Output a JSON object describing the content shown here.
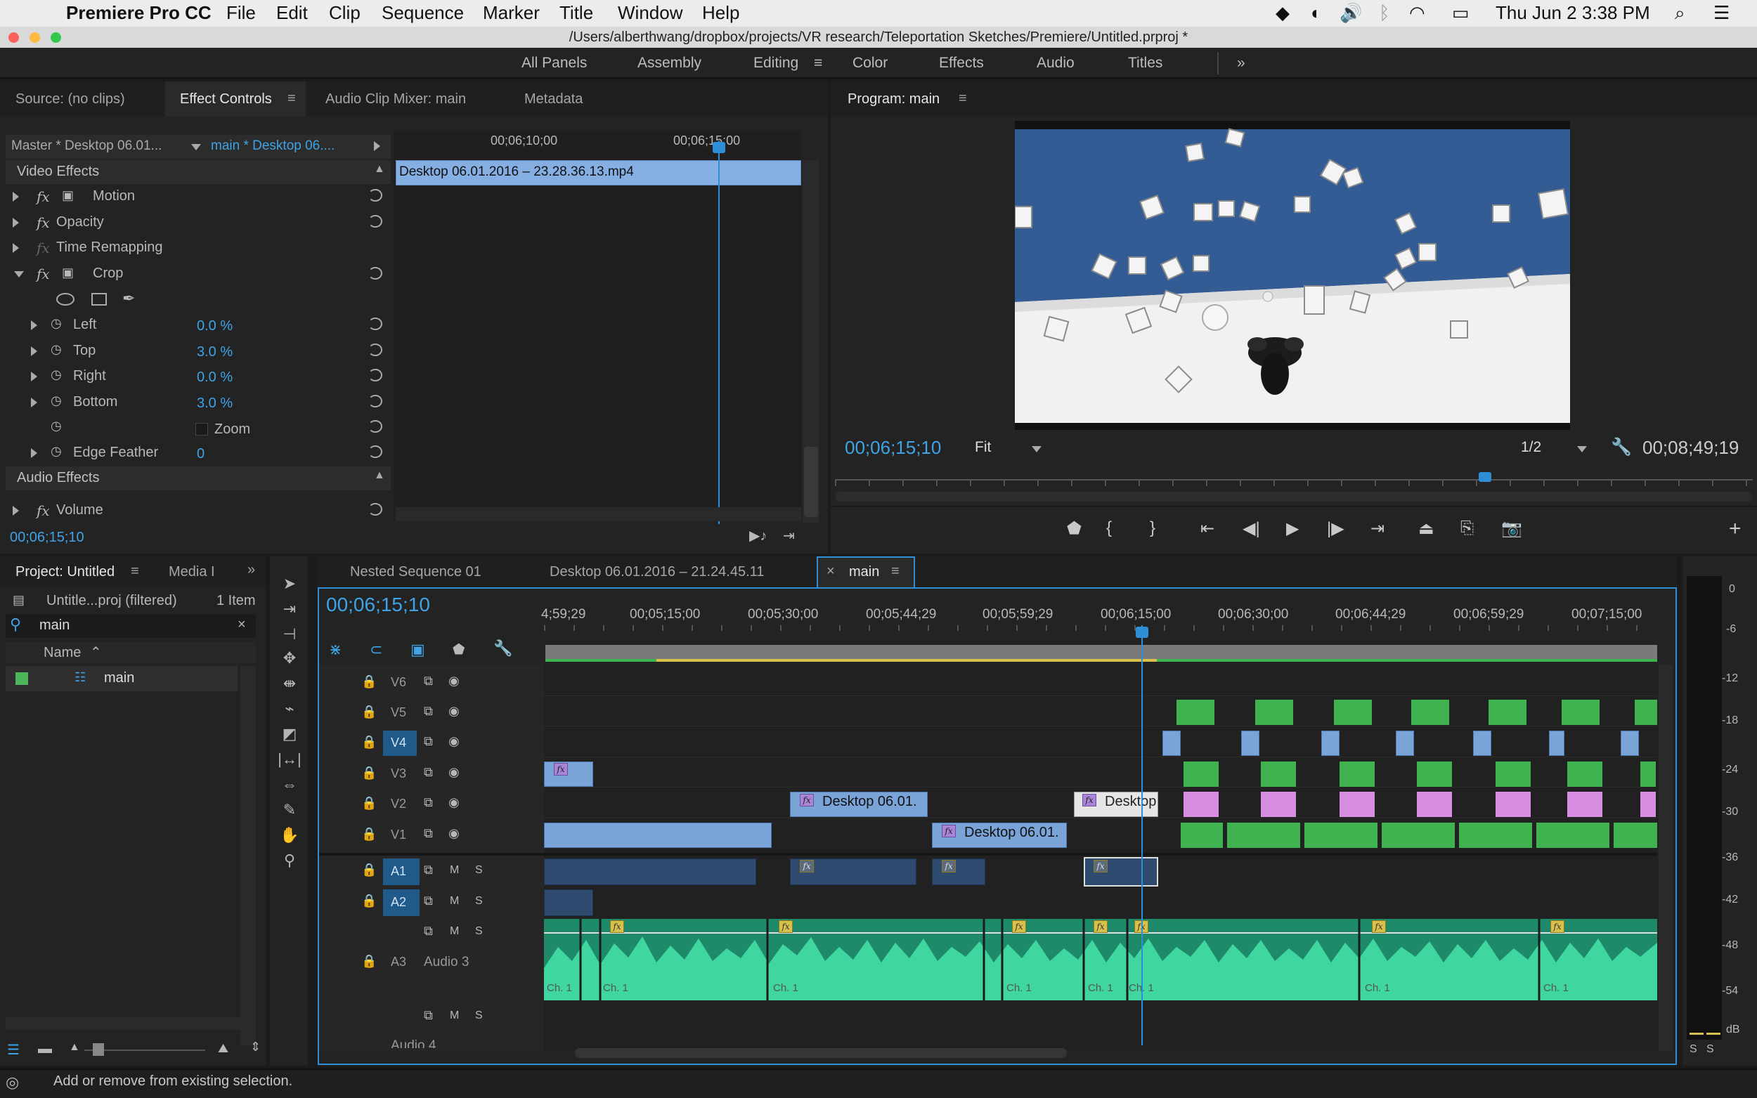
{
  "menubar": {
    "app": "Premiere Pro CC",
    "items": [
      "File",
      "Edit",
      "Clip",
      "Sequence",
      "Marker",
      "Title",
      "Window",
      "Help"
    ],
    "datetime": "Thu Jun 2  3:38 PM"
  },
  "window": {
    "title": "/Users/alberthwang/dropbox/projects/VR research/Teleportation Sketches/Premiere/Untitled.prproj *"
  },
  "workspaces": {
    "items": [
      "All Panels",
      "Assembly",
      "Editing",
      "Color",
      "Effects",
      "Audio",
      "Titles"
    ],
    "active": "Editing"
  },
  "source_panel": {
    "tabs": [
      "Source: (no clips)",
      "Effect Controls",
      "Audio Clip Mixer: main",
      "Metadata"
    ],
    "master_label": "Master * Desktop 06.01...",
    "clip_label": "main * Desktop 06....",
    "ruler": [
      "00;06;10;00",
      "00;06;15;00"
    ],
    "clip_name": "Desktop 06.01.2016 – 23.28.36.13.mp4",
    "video_effects": "Video Effects",
    "audio_effects": "Audio Effects",
    "effects": {
      "motion": "Motion",
      "opacity": "Opacity",
      "time_remap": "Time Remapping",
      "crop": "Crop",
      "volume": "Volume"
    },
    "crop_params": [
      {
        "name": "Left",
        "value": "0.0 %"
      },
      {
        "name": "Top",
        "value": "3.0 %"
      },
      {
        "name": "Right",
        "value": "0.0 %"
      },
      {
        "name": "Bottom",
        "value": "3.0 %"
      }
    ],
    "zoom": "Zoom",
    "edge_feather": "Edge Feather",
    "edge_value": "0",
    "timecode": "00;06;15;10"
  },
  "program": {
    "title": "Program: main",
    "timecode": "00;06;15;10",
    "fit": "Fit",
    "resolution": "1/2",
    "duration": "00;08;49;19"
  },
  "project": {
    "tabs": [
      "Project: Untitled",
      "Media I"
    ],
    "path": "Untitle...proj (filtered)",
    "count": "1 Item",
    "search": "main",
    "name_header": "Name",
    "item": "main"
  },
  "timeline": {
    "tabs": [
      "Nested Sequence 01",
      "Desktop 06.01.2016 – 21.24.45.11",
      "main"
    ],
    "timecode": "00;06;15;10",
    "ruler": [
      "4;59;29",
      "00;05;15;00",
      "00;05;30;00",
      "00;05;44;29",
      "00;05;59;29",
      "00;06;15;00",
      "00;06;30;00",
      "00;06;44;29",
      "00;06;59;29",
      "00;07;15;00"
    ],
    "video_tracks": [
      "V6",
      "V5",
      "V4",
      "V3",
      "V2",
      "V1"
    ],
    "audio_tracks": [
      "A1",
      "A2",
      "A3"
    ],
    "audio3_name": "Audio 3",
    "audio4_name": "Audio 4",
    "clip_v2a": "Desktop 06.01.",
    "clip_v2b": "Desktop",
    "clip_v1": "Desktop 06.01.",
    "ch_label": "Ch. 1"
  },
  "meter": {
    "labels": [
      "0",
      "-6",
      "-12",
      "-18",
      "-24",
      "-30",
      "-36",
      "-42",
      "-48",
      "-54",
      "dB"
    ],
    "solo": [
      "S",
      "S"
    ]
  },
  "status": "Add or remove from existing selection."
}
